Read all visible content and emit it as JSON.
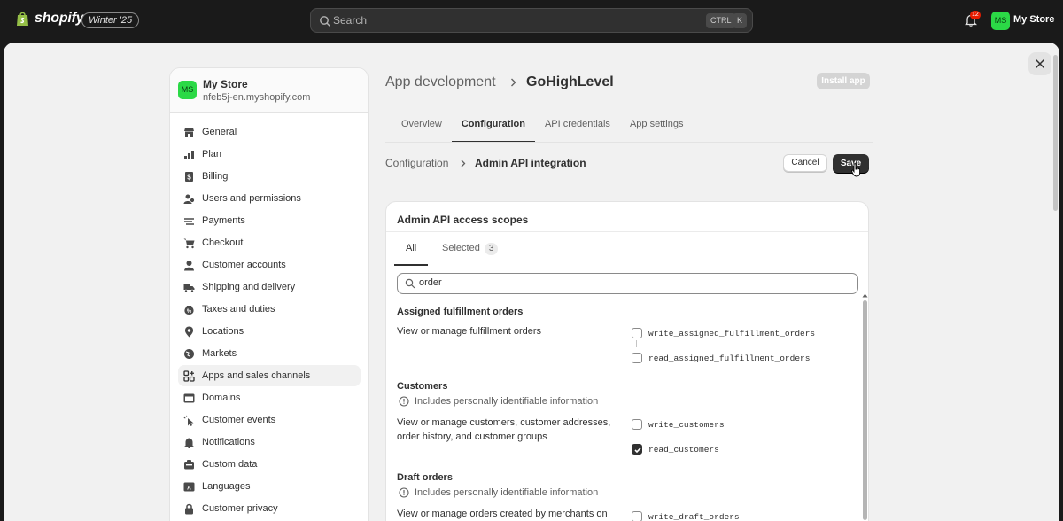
{
  "topbar": {
    "brand": "shopify",
    "edition_badge": "Winter '25",
    "search_placeholder": "Search",
    "shortcut_ctrl": "CTRL",
    "shortcut_k": "K",
    "notification_count": "12",
    "store_initials": "MS",
    "store_name": "My Store"
  },
  "sidebar": {
    "store_initials": "MS",
    "store_name": "My Store",
    "store_domain": "nfeb5j-en.myshopify.com",
    "items": [
      {
        "label": "General",
        "icon": "store-icon"
      },
      {
        "label": "Plan",
        "icon": "plan-icon"
      },
      {
        "label": "Billing",
        "icon": "billing-icon"
      },
      {
        "label": "Users and permissions",
        "icon": "users-icon"
      },
      {
        "label": "Payments",
        "icon": "payments-icon"
      },
      {
        "label": "Checkout",
        "icon": "cart-icon"
      },
      {
        "label": "Customer accounts",
        "icon": "person-icon"
      },
      {
        "label": "Shipping and delivery",
        "icon": "truck-icon"
      },
      {
        "label": "Taxes and duties",
        "icon": "tax-icon"
      },
      {
        "label": "Locations",
        "icon": "location-icon"
      },
      {
        "label": "Markets",
        "icon": "globe-icon"
      },
      {
        "label": "Apps and sales channels",
        "icon": "apps-icon"
      },
      {
        "label": "Domains",
        "icon": "domain-icon"
      },
      {
        "label": "Customer events",
        "icon": "cursor-click-icon"
      },
      {
        "label": "Notifications",
        "icon": "bell-icon"
      },
      {
        "label": "Custom data",
        "icon": "data-icon"
      },
      {
        "label": "Languages",
        "icon": "language-icon"
      },
      {
        "label": "Customer privacy",
        "icon": "lock-icon"
      }
    ],
    "active_index": 11
  },
  "header": {
    "crumb": "App development",
    "title": "GoHighLevel",
    "install_label": "Install app"
  },
  "tabs": [
    "Overview",
    "Configuration",
    "API credentials",
    "App settings"
  ],
  "active_tab": 1,
  "subheader": {
    "crumb": "Configuration",
    "title": "Admin API integration",
    "cancel_label": "Cancel",
    "save_label": "Save"
  },
  "card": {
    "title": "Admin API access scopes",
    "tab_all": "All",
    "tab_selected": "Selected",
    "selected_count": "3",
    "filter_value": "order",
    "groups": [
      {
        "title": "Assigned fulfillment orders",
        "pii": "",
        "description": "View or manage fulfillment orders",
        "scopes": [
          {
            "name": "write_assigned_fulfillment_orders",
            "checked": false
          },
          {
            "name": "read_assigned_fulfillment_orders",
            "checked": false
          }
        ]
      },
      {
        "title": "Customers",
        "pii": "Includes personally identifiable information",
        "description": "View or manage customers, customer addresses, order history, and customer groups",
        "scopes": [
          {
            "name": "write_customers",
            "checked": false
          },
          {
            "name": "read_customers",
            "checked": true
          }
        ]
      },
      {
        "title": "Draft orders",
        "pii": "Includes personally identifiable information",
        "description": "View or manage orders created by merchants on",
        "scopes": [
          {
            "name": "write_draft_orders",
            "checked": false
          }
        ]
      }
    ]
  },
  "colors": {
    "topbar": "#1a1a1a",
    "store_avatar": "#2bd946",
    "primary_button": "#303030",
    "notification": "#e51c00"
  }
}
